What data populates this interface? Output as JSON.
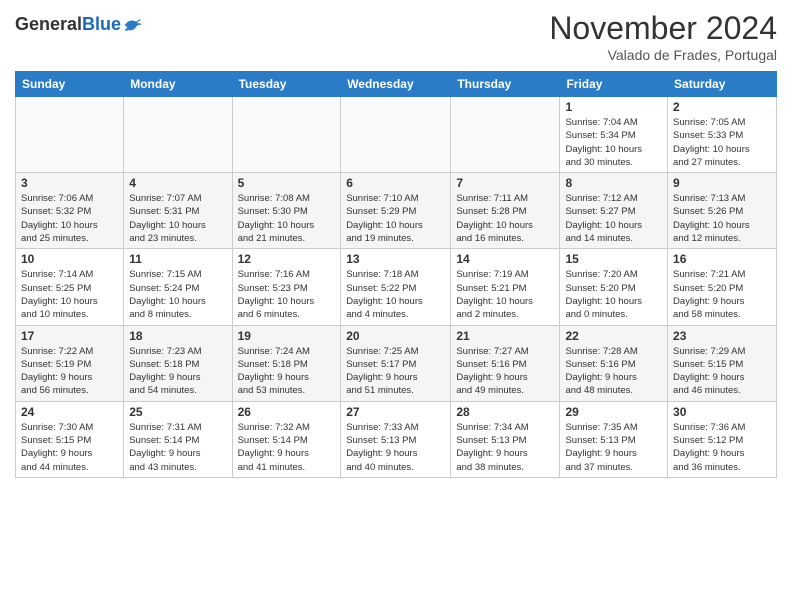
{
  "header": {
    "logo_general": "General",
    "logo_blue": "Blue",
    "month_title": "November 2024",
    "subtitle": "Valado de Frades, Portugal"
  },
  "weekdays": [
    "Sunday",
    "Monday",
    "Tuesday",
    "Wednesday",
    "Thursday",
    "Friday",
    "Saturday"
  ],
  "weeks": [
    [
      {
        "day": "",
        "info": ""
      },
      {
        "day": "",
        "info": ""
      },
      {
        "day": "",
        "info": ""
      },
      {
        "day": "",
        "info": ""
      },
      {
        "day": "",
        "info": ""
      },
      {
        "day": "1",
        "info": "Sunrise: 7:04 AM\nSunset: 5:34 PM\nDaylight: 10 hours\nand 30 minutes."
      },
      {
        "day": "2",
        "info": "Sunrise: 7:05 AM\nSunset: 5:33 PM\nDaylight: 10 hours\nand 27 minutes."
      }
    ],
    [
      {
        "day": "3",
        "info": "Sunrise: 7:06 AM\nSunset: 5:32 PM\nDaylight: 10 hours\nand 25 minutes."
      },
      {
        "day": "4",
        "info": "Sunrise: 7:07 AM\nSunset: 5:31 PM\nDaylight: 10 hours\nand 23 minutes."
      },
      {
        "day": "5",
        "info": "Sunrise: 7:08 AM\nSunset: 5:30 PM\nDaylight: 10 hours\nand 21 minutes."
      },
      {
        "day": "6",
        "info": "Sunrise: 7:10 AM\nSunset: 5:29 PM\nDaylight: 10 hours\nand 19 minutes."
      },
      {
        "day": "7",
        "info": "Sunrise: 7:11 AM\nSunset: 5:28 PM\nDaylight: 10 hours\nand 16 minutes."
      },
      {
        "day": "8",
        "info": "Sunrise: 7:12 AM\nSunset: 5:27 PM\nDaylight: 10 hours\nand 14 minutes."
      },
      {
        "day": "9",
        "info": "Sunrise: 7:13 AM\nSunset: 5:26 PM\nDaylight: 10 hours\nand 12 minutes."
      }
    ],
    [
      {
        "day": "10",
        "info": "Sunrise: 7:14 AM\nSunset: 5:25 PM\nDaylight: 10 hours\nand 10 minutes."
      },
      {
        "day": "11",
        "info": "Sunrise: 7:15 AM\nSunset: 5:24 PM\nDaylight: 10 hours\nand 8 minutes."
      },
      {
        "day": "12",
        "info": "Sunrise: 7:16 AM\nSunset: 5:23 PM\nDaylight: 10 hours\nand 6 minutes."
      },
      {
        "day": "13",
        "info": "Sunrise: 7:18 AM\nSunset: 5:22 PM\nDaylight: 10 hours\nand 4 minutes."
      },
      {
        "day": "14",
        "info": "Sunrise: 7:19 AM\nSunset: 5:21 PM\nDaylight: 10 hours\nand 2 minutes."
      },
      {
        "day": "15",
        "info": "Sunrise: 7:20 AM\nSunset: 5:20 PM\nDaylight: 10 hours\nand 0 minutes."
      },
      {
        "day": "16",
        "info": "Sunrise: 7:21 AM\nSunset: 5:20 PM\nDaylight: 9 hours\nand 58 minutes."
      }
    ],
    [
      {
        "day": "17",
        "info": "Sunrise: 7:22 AM\nSunset: 5:19 PM\nDaylight: 9 hours\nand 56 minutes."
      },
      {
        "day": "18",
        "info": "Sunrise: 7:23 AM\nSunset: 5:18 PM\nDaylight: 9 hours\nand 54 minutes."
      },
      {
        "day": "19",
        "info": "Sunrise: 7:24 AM\nSunset: 5:18 PM\nDaylight: 9 hours\nand 53 minutes."
      },
      {
        "day": "20",
        "info": "Sunrise: 7:25 AM\nSunset: 5:17 PM\nDaylight: 9 hours\nand 51 minutes."
      },
      {
        "day": "21",
        "info": "Sunrise: 7:27 AM\nSunset: 5:16 PM\nDaylight: 9 hours\nand 49 minutes."
      },
      {
        "day": "22",
        "info": "Sunrise: 7:28 AM\nSunset: 5:16 PM\nDaylight: 9 hours\nand 48 minutes."
      },
      {
        "day": "23",
        "info": "Sunrise: 7:29 AM\nSunset: 5:15 PM\nDaylight: 9 hours\nand 46 minutes."
      }
    ],
    [
      {
        "day": "24",
        "info": "Sunrise: 7:30 AM\nSunset: 5:15 PM\nDaylight: 9 hours\nand 44 minutes."
      },
      {
        "day": "25",
        "info": "Sunrise: 7:31 AM\nSunset: 5:14 PM\nDaylight: 9 hours\nand 43 minutes."
      },
      {
        "day": "26",
        "info": "Sunrise: 7:32 AM\nSunset: 5:14 PM\nDaylight: 9 hours\nand 41 minutes."
      },
      {
        "day": "27",
        "info": "Sunrise: 7:33 AM\nSunset: 5:13 PM\nDaylight: 9 hours\nand 40 minutes."
      },
      {
        "day": "28",
        "info": "Sunrise: 7:34 AM\nSunset: 5:13 PM\nDaylight: 9 hours\nand 38 minutes."
      },
      {
        "day": "29",
        "info": "Sunrise: 7:35 AM\nSunset: 5:13 PM\nDaylight: 9 hours\nand 37 minutes."
      },
      {
        "day": "30",
        "info": "Sunrise: 7:36 AM\nSunset: 5:12 PM\nDaylight: 9 hours\nand 36 minutes."
      }
    ]
  ]
}
